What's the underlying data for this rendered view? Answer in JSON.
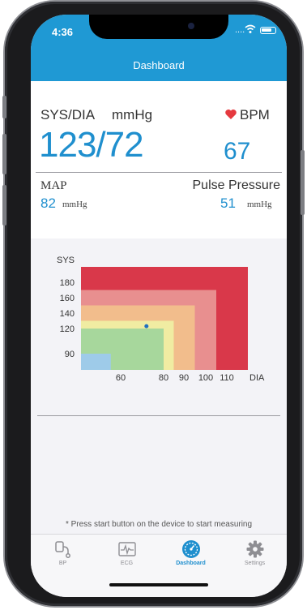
{
  "status": {
    "time": "4:36",
    "dots": "....",
    "accent": "#1f99d4"
  },
  "navbar": {
    "title": "Dashboard"
  },
  "reading": {
    "sysdia_label": "SYS/DIA",
    "unit_label": "mmHg",
    "bpm_label": "BPM",
    "sys": "123",
    "separator": "/",
    "dia": "72",
    "bpm": "67",
    "map_label": "MAP",
    "map_value": "82",
    "map_unit": "mmHg",
    "pp_label": "Pulse Pressure",
    "pp_value": "51",
    "pp_unit": "mmHg",
    "value_color": "#1f8fce",
    "heart_color": "#e5393f"
  },
  "chart_data": {
    "type": "scatter",
    "ylabel": "SYS",
    "xlabel": "DIA",
    "y_ticks": [
      "180",
      "160",
      "140",
      "120",
      "90"
    ],
    "x_ticks": [
      "60",
      "80",
      "90",
      "100",
      "110"
    ],
    "zones": [
      {
        "color": "#d9384a",
        "dia_max": 110,
        "sys_max": 180
      },
      {
        "color": "#e88f8f",
        "dia_max": 100,
        "sys_max": 160
      },
      {
        "color": "#f2bd8c",
        "dia_max": 90,
        "sys_max": 140
      },
      {
        "color": "#f0eca2",
        "dia_max": 80,
        "sys_max": 120
      },
      {
        "color": "#a7d79c",
        "dia_max": 60,
        "sys_max": 90
      },
      {
        "color": "#9ecbe9",
        "dia_max": 60,
        "sys_max": 90
      }
    ],
    "points": [
      {
        "dia": 72,
        "sys": 123,
        "color": "#1f6fc0"
      }
    ]
  },
  "hint": "* Press start button on the device to start measuring",
  "tabs": [
    {
      "label": "BP",
      "icon": "bp-cuff-icon",
      "active": false
    },
    {
      "label": "ECG",
      "icon": "ecg-icon",
      "active": false
    },
    {
      "label": "Dashboard",
      "icon": "dashboard-gauge-icon",
      "active": true
    },
    {
      "label": "Settings",
      "icon": "gear-icon",
      "active": false
    }
  ]
}
